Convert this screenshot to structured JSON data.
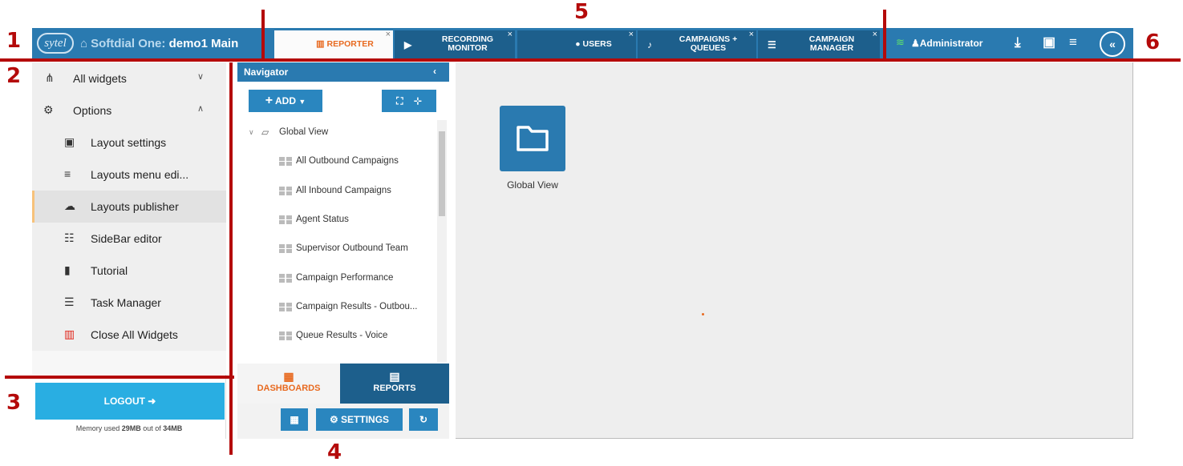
{
  "header": {
    "logo_text": "sytel",
    "app_title_prefix": "Softdial One: ",
    "app_title_main": "demo1 Main",
    "tabs": [
      {
        "label": "REPORTER",
        "icon": "bar-chart-icon",
        "active": true
      },
      {
        "label": "RECORDING MONITOR",
        "icon": "play-icon",
        "active": false
      },
      {
        "label": "USERS",
        "icon": "user-icon",
        "active": false
      },
      {
        "label": "CAMPAIGNS + QUEUES",
        "icon": "bell-icon",
        "active": false
      },
      {
        "label": "CAMPAIGN MANAGER",
        "icon": "list-icon",
        "active": false
      }
    ],
    "close_glyph": "×",
    "user": "Administrator",
    "icons": [
      "wifi-icon",
      "download-icon",
      "save-icon",
      "menu-icon",
      "collapse-left-icon"
    ]
  },
  "sidebar": {
    "items": [
      {
        "label": "All widgets",
        "icon": "sitemap-icon"
      },
      {
        "label": "Options",
        "icon": "gears-icon"
      },
      {
        "label": "Layout settings",
        "icon": "layout-icon"
      },
      {
        "label": "Layouts menu edi...",
        "icon": "bars-icon"
      },
      {
        "label": "Layouts publisher",
        "icon": "cloud-upload-icon",
        "selected": true
      },
      {
        "label": "SideBar editor",
        "icon": "list-icon"
      },
      {
        "label": "Tutorial",
        "icon": "book-icon"
      },
      {
        "label": "Task Manager",
        "icon": "tasks-icon"
      },
      {
        "label": "Close All Widgets",
        "icon": "trash-icon",
        "icon_color": "#e0261b"
      }
    ],
    "logout_label": "LOGOUT",
    "memory_prefix": "Memory used ",
    "memory_used": "29MB",
    "memory_mid": " out of ",
    "memory_total": "34MB"
  },
  "navigator": {
    "title": "Navigator",
    "add_label": "ADD",
    "tree_root": "Global View",
    "tree_items": [
      "All Outbound Campaigns",
      "All Inbound Campaigns",
      "Agent Status",
      "Supervisor Outbound Team",
      "Campaign Performance",
      "Campaign Results - Outbou...",
      "Queue Results - Voice"
    ],
    "bottom_tabs": [
      {
        "label": "DASHBOARDS",
        "active": true
      },
      {
        "label": "REPORTS",
        "active": false
      }
    ],
    "settings_label": "SETTINGS"
  },
  "canvas": {
    "folder_label": "Global View"
  },
  "annotations": {
    "numbers": [
      "1",
      "2",
      "3",
      "4",
      "5",
      "6"
    ]
  },
  "colors": {
    "topbar": "#2a7ab0",
    "accent_orange": "#e86a20",
    "logout_blue": "#29aee2",
    "annotation_red": "#b40a0a"
  }
}
